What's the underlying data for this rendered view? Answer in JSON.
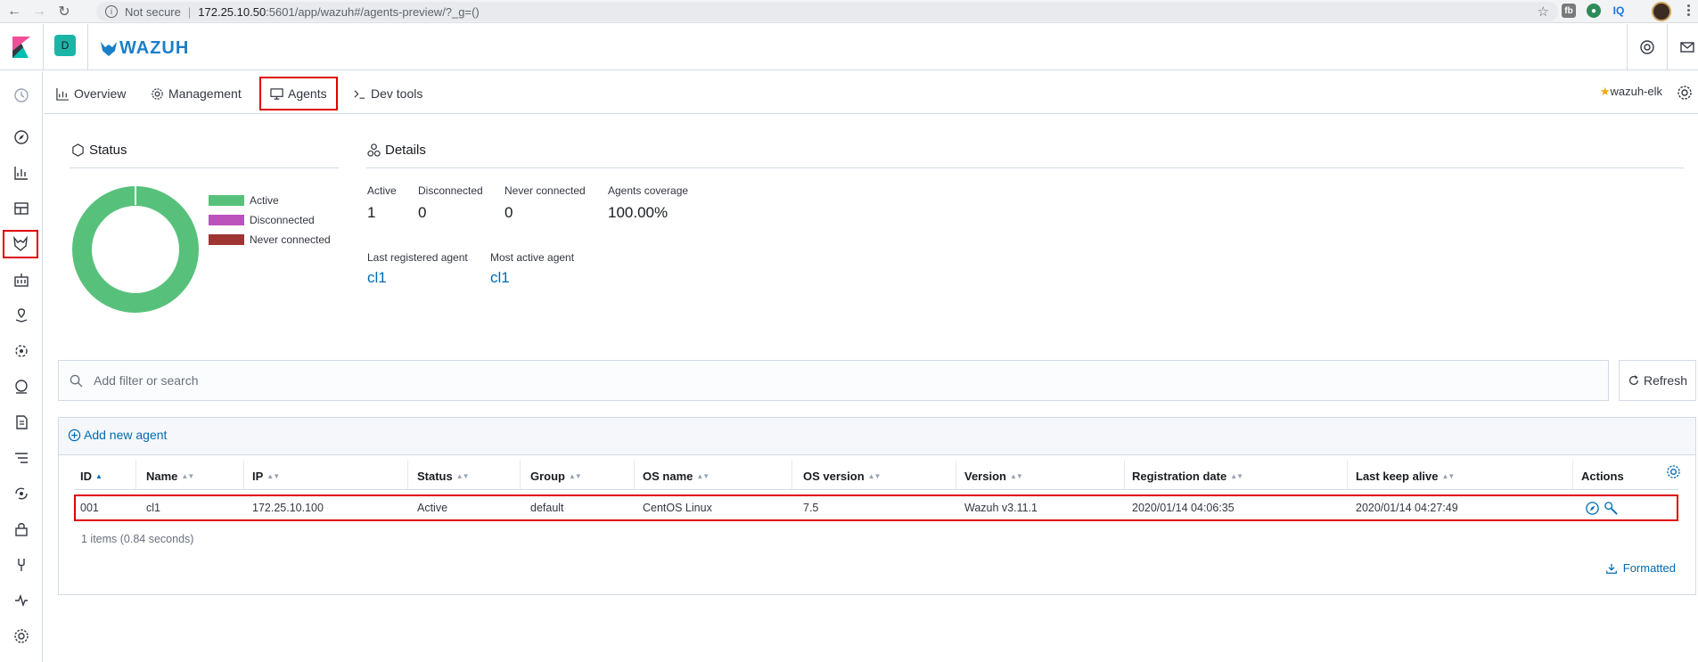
{
  "browser": {
    "security_label": "Not secure",
    "url_host": "172.25.10.50",
    "url_path": ":5601/app/wazuh#/agents-preview/?_g=()",
    "ext_iq": "IQ"
  },
  "header": {
    "space_initial": "D",
    "brand": "WAZUH"
  },
  "wazuh_menu": {
    "tabs": [
      {
        "label": "Overview"
      },
      {
        "label": "Management"
      },
      {
        "label": "Agents"
      },
      {
        "label": "Dev tools"
      }
    ],
    "api_name": "wazuh-elk"
  },
  "status_panel": {
    "title": "Status",
    "legend": [
      {
        "label": "Active",
        "color": "#57c17b"
      },
      {
        "label": "Disconnected",
        "color": "#bc52bc"
      },
      {
        "label": "Never connected",
        "color": "#9e3533"
      }
    ]
  },
  "details_panel": {
    "title": "Details",
    "stats": [
      {
        "label": "Active",
        "value": "1"
      },
      {
        "label": "Disconnected",
        "value": "0"
      },
      {
        "label": "Never connected",
        "value": "0"
      },
      {
        "label": "Agents coverage",
        "value": "100.00%"
      }
    ],
    "last_registered_label": "Last registered agent",
    "last_registered_value": "cl1",
    "most_active_label": "Most active agent",
    "most_active_value": "cl1"
  },
  "search": {
    "placeholder": "Add filter or search"
  },
  "refresh_label": "Refresh",
  "agents_table": {
    "add_label": "Add new agent",
    "columns": [
      "ID",
      "Name",
      "IP",
      "Status",
      "Group",
      "OS name",
      "OS version",
      "Version",
      "Registration date",
      "Last keep alive",
      "Actions"
    ],
    "rows": [
      {
        "id": "001",
        "name": "cl1",
        "ip": "172.25.10.100",
        "status": "Active",
        "group": "default",
        "os_name": "CentOS Linux",
        "os_version": "7.5",
        "version": "Wazuh v3.11.1",
        "registration_date": "2020/01/14 04:06:35",
        "last_keep_alive": "2020/01/14 04:27:49"
      }
    ],
    "count_text": "1 items (0.84 seconds)",
    "formatted_label": "Formatted"
  },
  "colors": {
    "accent": "#006bb4",
    "highlight": "#e00000",
    "active": "#57c17b",
    "disconnected": "#bc52bc",
    "never_connected": "#9e3533"
  },
  "status_summary": {
    "active": 1,
    "disconnected": 0,
    "never_connected": 0
  }
}
